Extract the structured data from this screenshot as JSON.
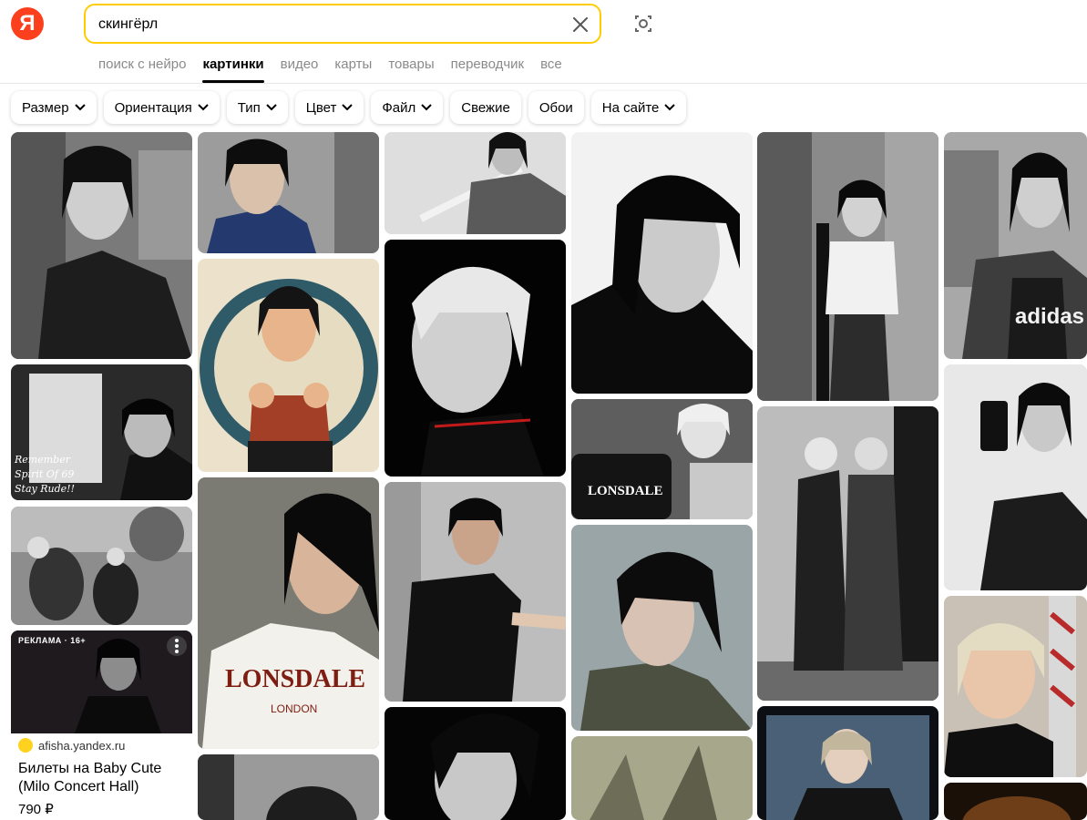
{
  "logo": "Я",
  "search": {
    "value": "скингёрл",
    "placeholder": ""
  },
  "tabs": [
    {
      "label": "поиск с нейро",
      "active": false
    },
    {
      "label": "картинки",
      "active": true
    },
    {
      "label": "видео",
      "active": false
    },
    {
      "label": "карты",
      "active": false
    },
    {
      "label": "товары",
      "active": false
    },
    {
      "label": "переводчик",
      "active": false
    },
    {
      "label": "все",
      "active": false
    }
  ],
  "filters": [
    {
      "label": "Размер",
      "dropdown": true
    },
    {
      "label": "Ориентация",
      "dropdown": true
    },
    {
      "label": "Тип",
      "dropdown": true
    },
    {
      "label": "Цвет",
      "dropdown": true
    },
    {
      "label": "Файл",
      "dropdown": true
    },
    {
      "label": "Свежие",
      "dropdown": false
    },
    {
      "label": "Обои",
      "dropdown": false
    },
    {
      "label": "На сайте",
      "dropdown": true
    }
  ],
  "ad": {
    "label": "РЕКЛАМА · 16+",
    "domain": "afisha.yandex.ru",
    "title": "Билеты на Baby Cute (Milo Concert Hall)",
    "price": "790 ₽"
  },
  "image_captions": {
    "remember": "Remember\nSpirit Of 69\nStay Rude!!",
    "lonsdale_shirt": "LONSDALE",
    "lonsdale_sub": "LONDON",
    "lonsdale_bag": "LONSDALE",
    "adidas": "adidas"
  },
  "colors": {
    "accent": "#fc3f1d",
    "search_border": "#ffcc00",
    "tab_inactive": "#8a8a8a"
  }
}
